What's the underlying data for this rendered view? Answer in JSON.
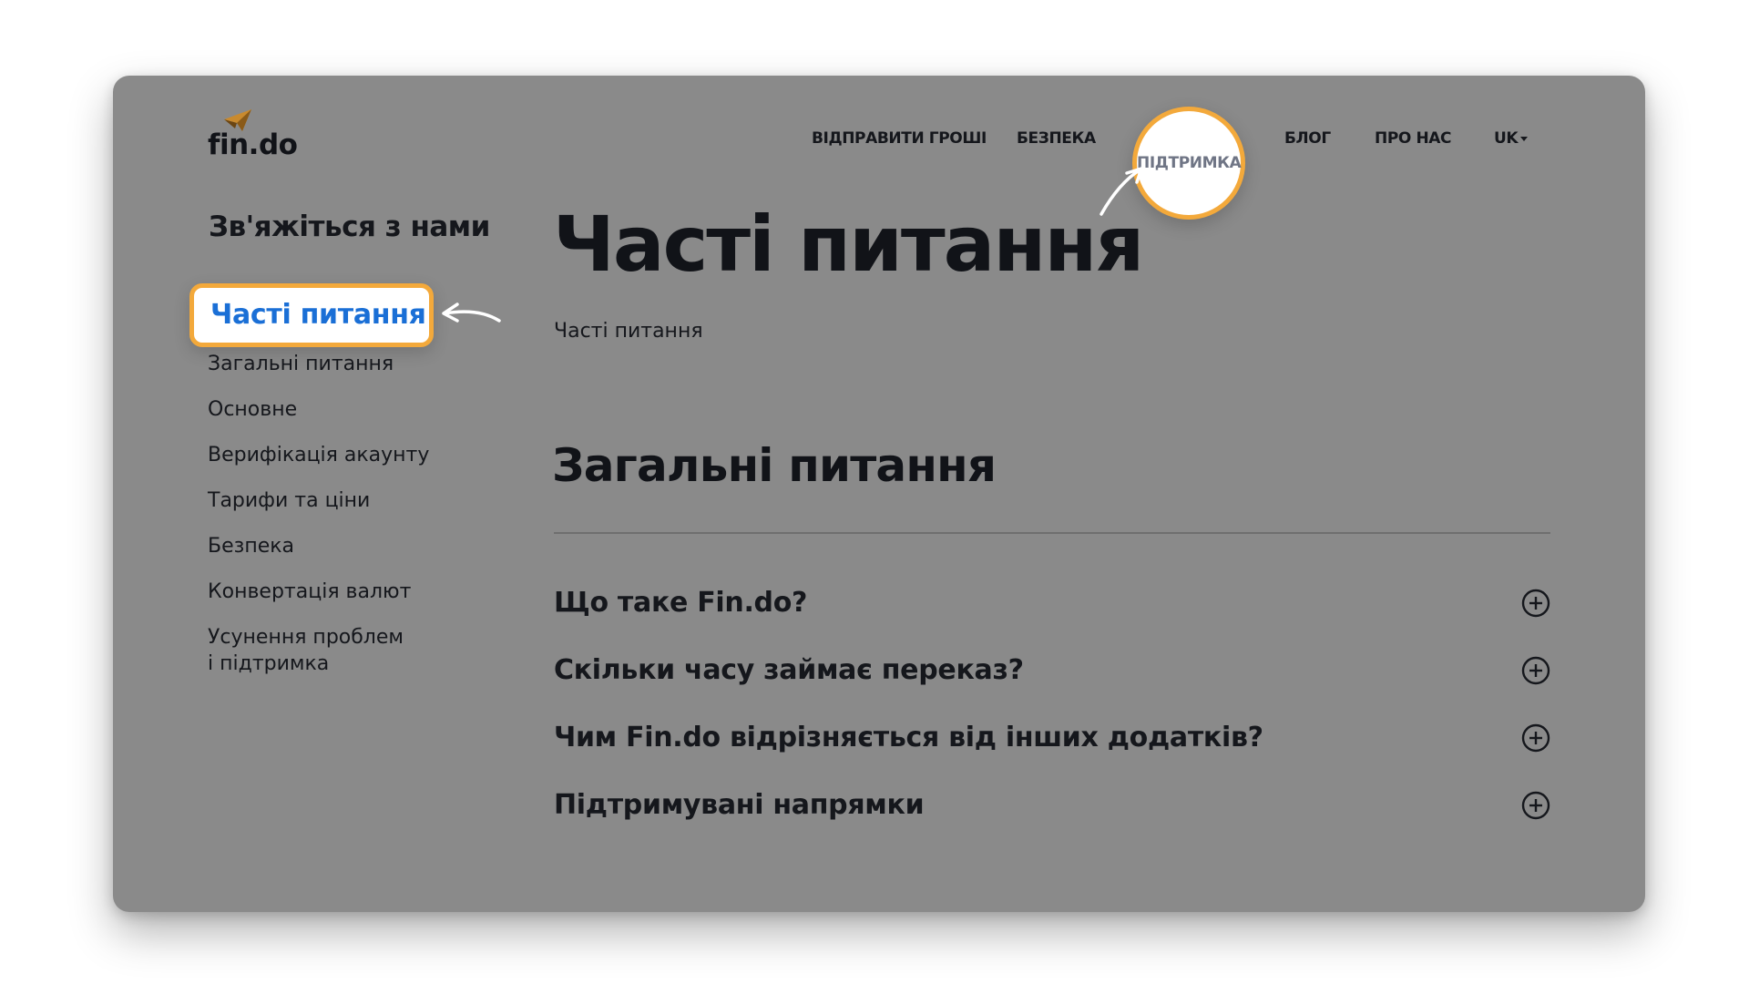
{
  "brand": {
    "logo_text": "fin.do",
    "accent": "#f3a93b",
    "active_link_color": "#1a6fd6",
    "card_bg": "#8a8a8a"
  },
  "nav": {
    "send_money": "ВІДПРАВИТИ ГРОШІ",
    "security": "БЕЗПЕКА",
    "support": "ПІДТРИМКА",
    "blog": "БЛОГ",
    "about": "ПРО НАС",
    "language": "UK"
  },
  "sidebar": {
    "heading": "Зв'яжіться з нами",
    "active_item": "Часті питання",
    "items": [
      {
        "label": "Загальні питання"
      },
      {
        "label": "Основне"
      },
      {
        "label": "Верифікація акаунту"
      },
      {
        "label": "Тарифи та ціни"
      },
      {
        "label": "Безпека"
      },
      {
        "label": "Конвертація валют"
      },
      {
        "label": "Усунення проблем"
      },
      {
        "label": "і підтримка"
      }
    ]
  },
  "main": {
    "title": "Часті питання",
    "breadcrumb": "Часті питання",
    "section_title": "Загальні питання",
    "faqs": [
      {
        "question": "Що таке Fin.do?",
        "icon": "plus-circle-icon"
      },
      {
        "question": "Скільки часу займає переказ?",
        "icon": "plus-circle-icon"
      },
      {
        "question": "Чим Fin.do відрізняється від інших додатків?",
        "icon": "plus-circle-icon"
      },
      {
        "question": "Підтримувані напрямки",
        "icon": "plus-circle-icon"
      }
    ]
  }
}
